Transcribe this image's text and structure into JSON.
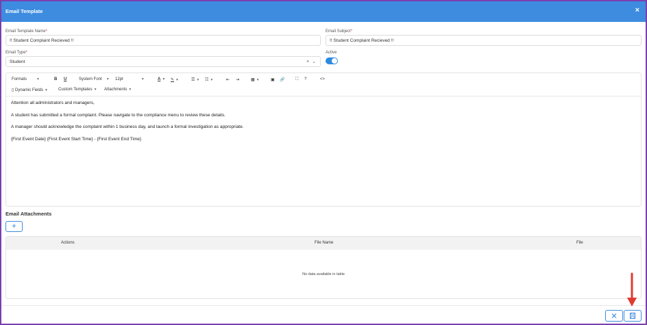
{
  "dialog": {
    "title": "Email Template",
    "close_glyph": "×"
  },
  "form": {
    "name_label": "Email Template Name",
    "name_value": "!! Student Complaint Recieved !!",
    "subject_label": "Email Subject",
    "subject_value": "!! Student Complaint Recieved !!",
    "type_label": "Email Type",
    "type_value": "Student",
    "active_label": "Active",
    "active": true,
    "required_mark": "*"
  },
  "editor": {
    "formats": "Formats",
    "bold": "B",
    "underline": "U",
    "font": "System Font",
    "size": "12pt",
    "dynamic_fields": "Dynamic Fields",
    "custom_templates": "Custom Templates",
    "attachments": "Attachments",
    "code_glyph": "<>",
    "content": [
      "Attention all administrators and managers,",
      "A student has submitted a formal complaint. Please navigate to the compliance menu to review these details.",
      "A manager should acknowledge the complaint within 1 business day, and launch a formal investigation as appropriate.",
      "{First Event Date} {First Event Start Time} - {First Event End Time}"
    ]
  },
  "attachments": {
    "title": "Email Attachments",
    "add_glyph": "+",
    "columns": [
      "Actions",
      "File Name",
      "File"
    ],
    "empty_text": "No data available in table"
  },
  "colors": {
    "header": "#3d8ce0",
    "accent": "#3d8ce0",
    "frame": "#7a3fae",
    "arrow": "#e03a2f"
  }
}
